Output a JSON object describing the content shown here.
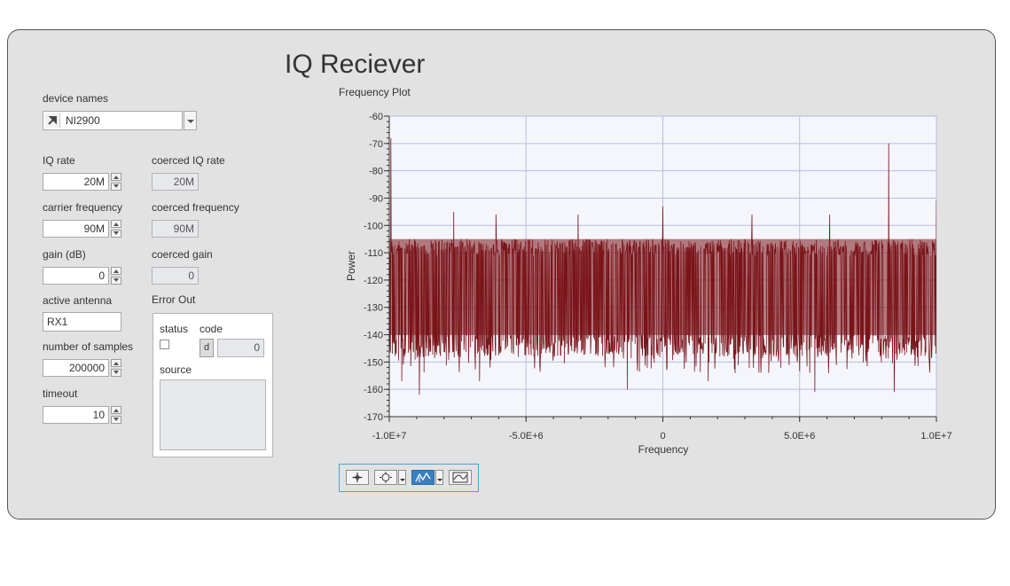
{
  "title": "IQ Reciever",
  "device": {
    "label": "device names",
    "value": "NI2900"
  },
  "iq_rate": {
    "label": "IQ rate",
    "value": "20M"
  },
  "coerced_iq_rate": {
    "label": "coerced IQ rate",
    "value": "20M"
  },
  "carrier_frequency": {
    "label": "carrier frequency",
    "value": "90M"
  },
  "coerced_frequency": {
    "label": "coerced frequency",
    "value": "90M"
  },
  "gain": {
    "label": "gain (dB)",
    "value": "0"
  },
  "coerced_gain": {
    "label": "coerced gain",
    "value": "0"
  },
  "active_antenna": {
    "label": "active antenna",
    "value": "RX1"
  },
  "number_of_samples": {
    "label": "number of samples",
    "value": "200000"
  },
  "timeout": {
    "label": "timeout",
    "value": "10"
  },
  "error_out": {
    "label": "Error Out",
    "status_label": "status",
    "code_label": "code",
    "code_value": "0",
    "source_label": "source",
    "source_value": ""
  },
  "plot": {
    "label": "Frequency Plot"
  },
  "colors": {
    "panel": "#e2e2e2",
    "plot_bg": "#f4f6fb",
    "trace": "#7a1419",
    "grid": "#b9bce0",
    "toolbar_border": "#4aa3d6",
    "active_tool": "#3c7fc0"
  },
  "chart_data": {
    "type": "line",
    "title": "",
    "xlabel": "Frequency",
    "ylabel": "Power",
    "xlim": [
      -10000000,
      10000000
    ],
    "ylim": [
      -170,
      -60
    ],
    "x_ticks": [
      -10000000,
      -5000000,
      0,
      5000000,
      10000000
    ],
    "x_tick_labels": [
      "-1.0E+7",
      "-5.0E+6",
      "0",
      "5.0E+6",
      "1.0E+7"
    ],
    "y_ticks": [
      -60,
      -70,
      -80,
      -90,
      -100,
      -110,
      -120,
      -130,
      -140,
      -150,
      -160,
      -170
    ],
    "y_tick_labels": [
      "-60",
      "-70",
      "-80",
      "-90",
      "-100",
      "-110",
      "-120",
      "-130",
      "-140",
      "-150",
      "-160",
      "-170"
    ],
    "grid": true,
    "series": [
      {
        "color": "#7a1419",
        "noise_floor": {
          "upper": -105,
          "lower": -140,
          "mean": -122
        },
        "peaks": [
          {
            "x": -9950000,
            "y": -68
          },
          {
            "x": -7650000,
            "y": -95
          },
          {
            "x": -6100000,
            "y": -96
          },
          {
            "x": -3100000,
            "y": -96
          },
          {
            "x": 0,
            "y": -93
          },
          {
            "x": 3250000,
            "y": -96
          },
          {
            "x": 6100000,
            "y": -96
          },
          {
            "x": 8250000,
            "y": -70
          },
          {
            "x": 10000000,
            "y": -91
          }
        ],
        "dips": [
          {
            "x": -8900000,
            "y": -162
          },
          {
            "x": -9550000,
            "y": -157
          },
          {
            "x": -6700000,
            "y": -157
          },
          {
            "x": -1300000,
            "y": -160
          },
          {
            "x": 1650000,
            "y": -157
          },
          {
            "x": 5550000,
            "y": -161
          },
          {
            "x": 8450000,
            "y": -161
          }
        ]
      }
    ]
  }
}
